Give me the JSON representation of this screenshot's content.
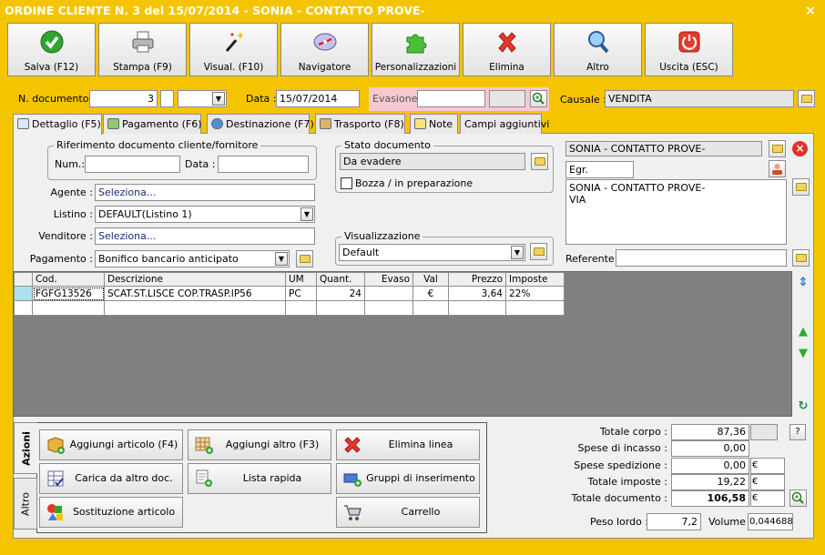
{
  "window": {
    "title": "ORDINE CLIENTE N. 3 del 15/07/2014 - SONIA - CONTATTO PROVE-",
    "close": "×"
  },
  "toolbar": [
    {
      "label": "Salva (F12)",
      "icon": "check-icon"
    },
    {
      "label": "Stampa (F9)",
      "icon": "printer-icon"
    },
    {
      "label": "Visual. (F10)",
      "icon": "magic-wand-icon"
    },
    {
      "label": "Navigatore",
      "icon": "compass-icon"
    },
    {
      "label": "Personalizzazioni",
      "icon": "puzzle-icon"
    },
    {
      "label": "Elimina",
      "icon": "delete-x-icon"
    },
    {
      "label": "Altro",
      "icon": "magnifier-icon"
    },
    {
      "label": "Uscita (ESC)",
      "icon": "power-icon"
    }
  ],
  "header": {
    "ndoc_label": "N. documento :",
    "ndoc_value": "3",
    "data_label": "Data :",
    "data_value": "15/07/2014",
    "evasione_label": "Evasione:",
    "evasione_value": "",
    "causale_label": "Causale :",
    "causale_value": "VENDITA"
  },
  "tabs": [
    {
      "label": "Dettaglio (F5)"
    },
    {
      "label": "Pagamento (F6)"
    },
    {
      "label": "Destinazione (F7)"
    },
    {
      "label": "Trasporto (F8)"
    },
    {
      "label": "Note"
    },
    {
      "label": "Campi aggiuntivi"
    }
  ],
  "rif": {
    "title": "Riferimento documento cliente/fornitore",
    "num_label": "Num.:",
    "num_value": "",
    "data_label": "Data :",
    "data_value": ""
  },
  "fields": {
    "agente_label": "Agente :",
    "agente_value": "Seleziona...",
    "listino_label": "Listino :",
    "listino_value": "DEFAULT(Listino 1)",
    "venditore_label": "Venditore :",
    "venditore_value": "Seleziona...",
    "pagamento_label": "Pagamento :",
    "pagamento_value": "Bonifico bancario anticipato"
  },
  "stato": {
    "title": "Stato documento",
    "value": "Da evadere",
    "bozza_label": "Bozza / in preparazione",
    "bozza_checked": false
  },
  "visual": {
    "title": "Visualizzazione",
    "value": "Default"
  },
  "cliente": {
    "name": "SONIA - CONTATTO PROVE-",
    "title": "Egr.",
    "address_line1": "SONIA - CONTATTO PROVE-",
    "address_line2": "VIA",
    "referente_label": "Referente",
    "referente_value": ""
  },
  "grid": {
    "columns": [
      "Cod.",
      "Descrizione",
      "UM",
      "Quant.",
      "Evaso",
      "Val",
      "Prezzo",
      "Imposte"
    ],
    "rows": [
      [
        "FGFG13526",
        "SCAT.ST.LISCE COP.TRASP.IP56",
        "PC",
        "24",
        "",
        "€",
        "3,64",
        "22%"
      ],
      [
        "",
        "",
        "",
        "",
        "",
        "",
        "",
        ""
      ]
    ]
  },
  "azioni": {
    "tab_azioni": "Azioni",
    "tab_altro": "Altro",
    "buttons": [
      {
        "label": "Aggiungi articolo (F4)"
      },
      {
        "label": "Aggiungi altro (F3)"
      },
      {
        "label": "Elimina linea"
      },
      {
        "label": "Carica da altro doc."
      },
      {
        "label": "Lista rapida"
      },
      {
        "label": "Gruppi di inserimento"
      },
      {
        "label": "Sostituzione articolo"
      },
      {
        "label": "Carrello"
      }
    ]
  },
  "totali": {
    "corpo_label": "Totale corpo :",
    "corpo_value": "87,36",
    "help": "?",
    "incasso_label": "Spese di incasso :",
    "incasso_value": "0,00",
    "spedizione_label": "Spese spedizione :",
    "spedizione_value": "0,00",
    "spedizione_unit": "€",
    "imposte_label": "Totale imposte :",
    "imposte_value": "19,22",
    "imposte_unit": "€",
    "documento_label": "Totale documento :",
    "documento_value": "106,58",
    "documento_unit": "€",
    "peso_label": "Peso lordo :",
    "peso_value": "7,2",
    "volume_label": "Volume :",
    "volume_value": "0,044688"
  },
  "colors": {
    "window_bg": "#f5c400",
    "panel_bg": "#f0f0f0",
    "grid_bg": "#808080",
    "selection": "#aee0ee"
  }
}
